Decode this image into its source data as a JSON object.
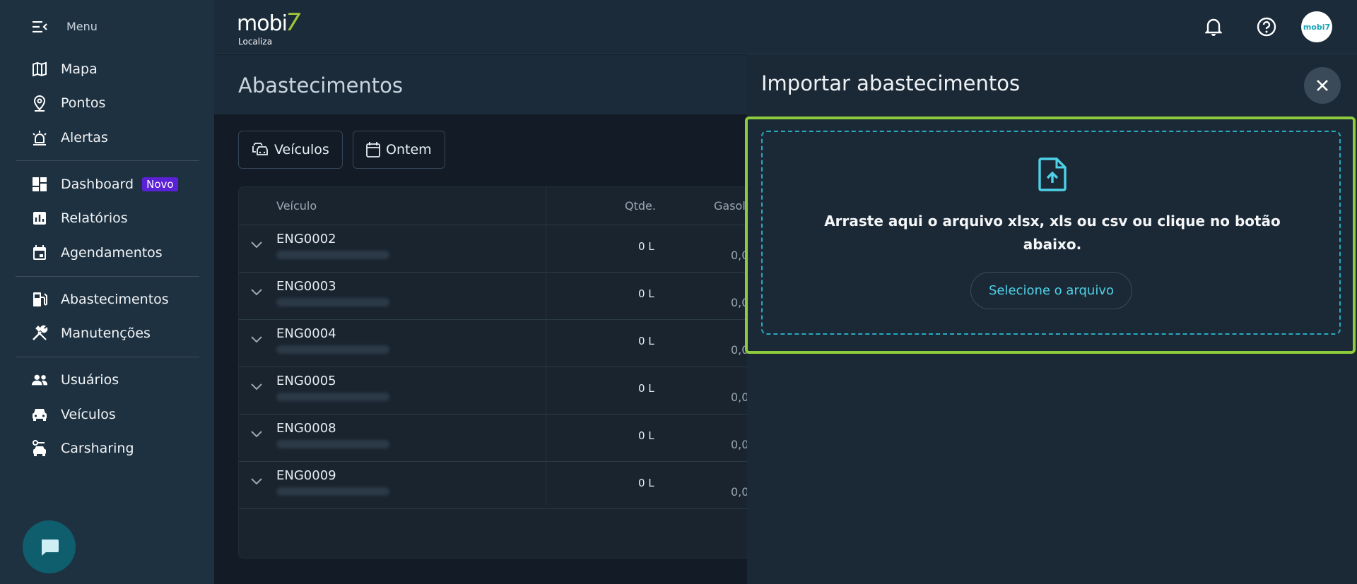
{
  "sidebar": {
    "menu_label": "Menu",
    "items": [
      {
        "label": "Mapa",
        "icon": "map-icon"
      },
      {
        "label": "Pontos",
        "icon": "location-pin-icon"
      },
      {
        "label": "Alertas",
        "icon": "siren-icon"
      },
      {
        "label": "Dashboard",
        "icon": "dashboard-icon",
        "badge": "Novo"
      },
      {
        "label": "Relatórios",
        "icon": "report-icon"
      },
      {
        "label": "Agendamentos",
        "icon": "calendar-icon"
      },
      {
        "label": "Abastecimentos",
        "icon": "fuel-pump-icon"
      },
      {
        "label": "Manutenções",
        "icon": "tools-icon"
      },
      {
        "label": "Usuários",
        "icon": "users-icon"
      },
      {
        "label": "Veículos",
        "icon": "car-icon"
      },
      {
        "label": "Carsharing",
        "icon": "carsharing-icon"
      }
    ]
  },
  "topbar": {
    "brand_name": "mobi",
    "brand_seven": "7",
    "brand_sub": "Localiza",
    "avatar_text": "mobi7"
  },
  "main": {
    "title": "Abastecimentos",
    "filters": [
      {
        "label": "Veículos",
        "icon": "vehicles-icon"
      },
      {
        "label": "Ontem",
        "icon": "calendar-icon"
      }
    ],
    "table": {
      "headers": {
        "vehicle": "Veículo",
        "qty": "Qtde.",
        "gas": "Gasol"
      },
      "rows": [
        {
          "vehicle": "ENG0002",
          "qty": "0 L",
          "gas": "0,0"
        },
        {
          "vehicle": "ENG0003",
          "qty": "0 L",
          "gas": "0,0"
        },
        {
          "vehicle": "ENG0004",
          "qty": "0 L",
          "gas": "0,0"
        },
        {
          "vehicle": "ENG0005",
          "qty": "0 L",
          "gas": "0,0"
        },
        {
          "vehicle": "ENG0008",
          "qty": "0 L",
          "gas": "0,0"
        },
        {
          "vehicle": "ENG0009",
          "qty": "0 L",
          "gas": "0,0"
        }
      ]
    }
  },
  "drawer": {
    "title": "Importar abastecimentos",
    "dropzone_text": "Arraste aqui o arquivo xlsx, xls ou csv ou clique no botão abaixo.",
    "select_button": "Selecione o arquivo"
  },
  "colors": {
    "accent": "#4ed0e6",
    "focus": "#8ccc3c",
    "badge": "#5b21d6",
    "sidebar": "#1e3140"
  }
}
